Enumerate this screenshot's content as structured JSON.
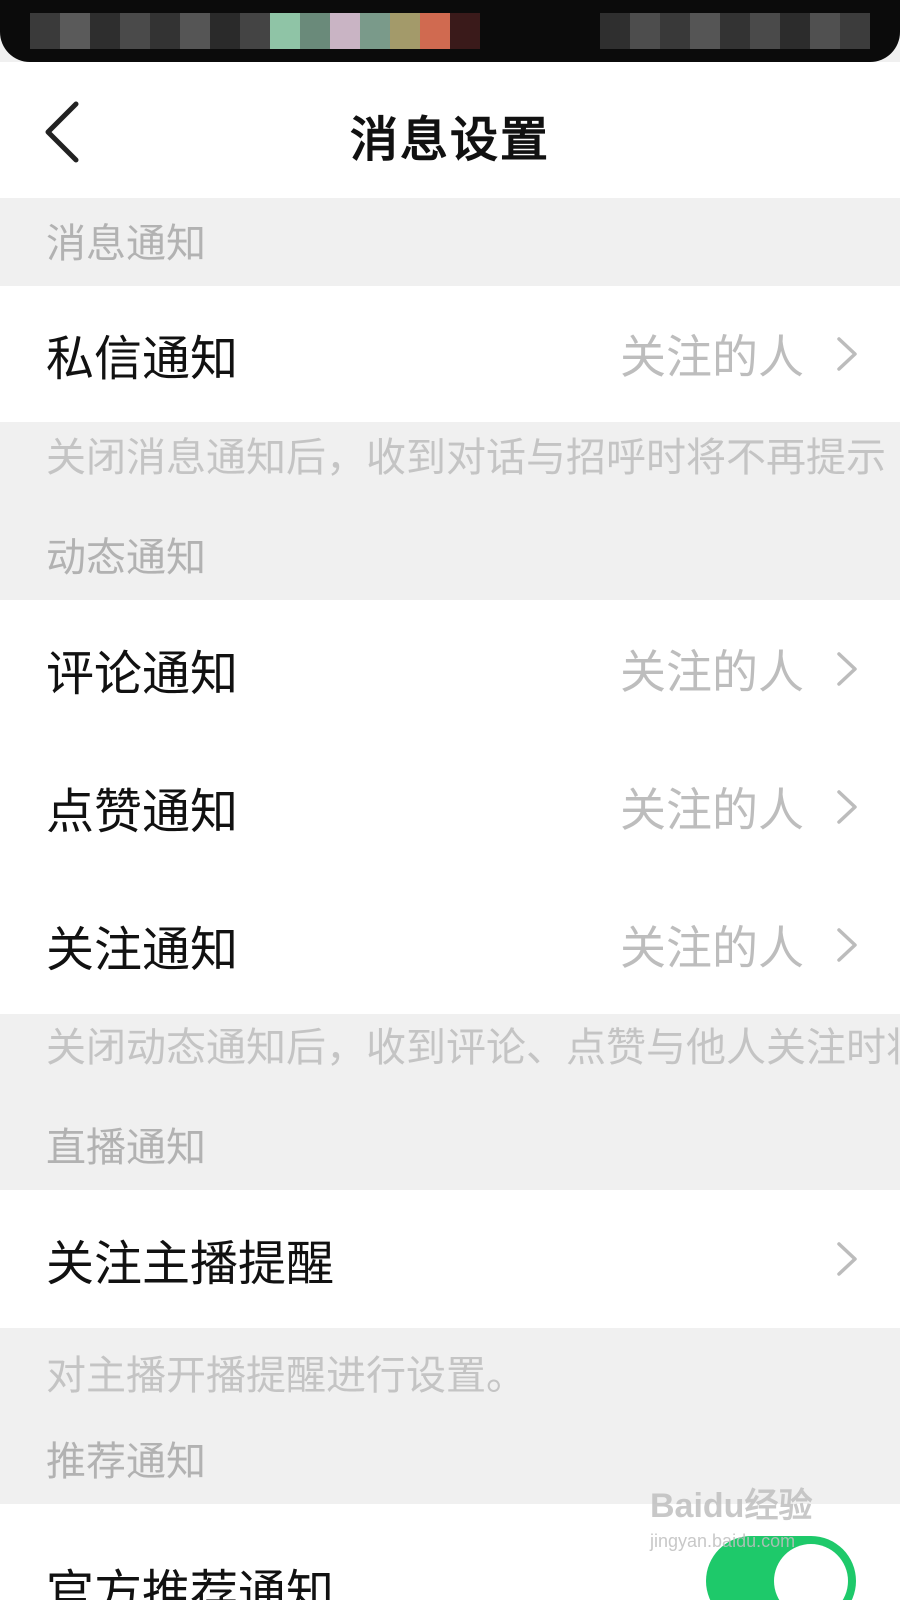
{
  "page": {
    "title": "消息设置"
  },
  "colors": {
    "background": "#f0f0f0",
    "row_background": "#ffffff",
    "toggle_on": "#1ec96a",
    "secondary_text": "#bdbdbd"
  },
  "sections": [
    {
      "header": "消息通知",
      "rows": [
        {
          "label": "私信通知",
          "value": "关注的人"
        }
      ],
      "note": "关闭消息通知后，收到对话与招呼时将不再提示"
    },
    {
      "header": "动态通知",
      "rows": [
        {
          "label": "评论通知",
          "value": "关注的人"
        },
        {
          "label": "点赞通知",
          "value": "关注的人"
        },
        {
          "label": "关注通知",
          "value": "关注的人"
        }
      ],
      "note": "关闭动态通知后，收到评论、点赞与他人关注时将不再提示"
    },
    {
      "header": "直播通知",
      "rows": [
        {
          "label": "关注主播提醒",
          "value": ""
        }
      ],
      "note": "对主播开播提醒进行设置。"
    },
    {
      "header": "推荐通知",
      "rows": [
        {
          "label": "官方推荐通知",
          "toggle": "on"
        }
      ]
    }
  ],
  "watermark": {
    "logo": "Baidu经验",
    "url": "jingyan.baidu.com"
  }
}
